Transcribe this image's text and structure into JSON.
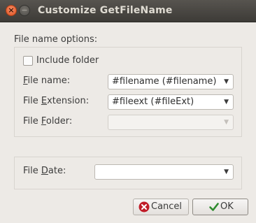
{
  "window": {
    "title": "Customize GetFileName",
    "close_glyph": "×",
    "minimize_glyph": "—"
  },
  "section": {
    "label": "File name options:"
  },
  "include_folder": {
    "label": "Include folder",
    "checked": false
  },
  "fields": {
    "file_name": {
      "pre": "",
      "mn": "F",
      "post": "ile name:",
      "value": "#filename (#filename)"
    },
    "file_extension": {
      "pre": "File ",
      "mn": "E",
      "post": "xtension:",
      "value": "#fileext (#fileExt)"
    },
    "file_folder": {
      "pre": "File ",
      "mn": "F",
      "post": "older:",
      "value": "",
      "disabled": true
    },
    "file_date": {
      "pre": "File ",
      "mn": "D",
      "post": "ate:",
      "value": ""
    }
  },
  "buttons": {
    "cancel": {
      "label": "Cancel",
      "icon": "cancel-icon"
    },
    "ok": {
      "label": "OK",
      "icon": "checkmark-icon"
    }
  },
  "dropdown_arrow": "▼",
  "colors": {
    "background": "#edeae6",
    "titlebar": "#3d3b37",
    "close_button": "#e95420",
    "cancel_icon": "#c01c28",
    "ok_icon": "#2e8b2e"
  }
}
